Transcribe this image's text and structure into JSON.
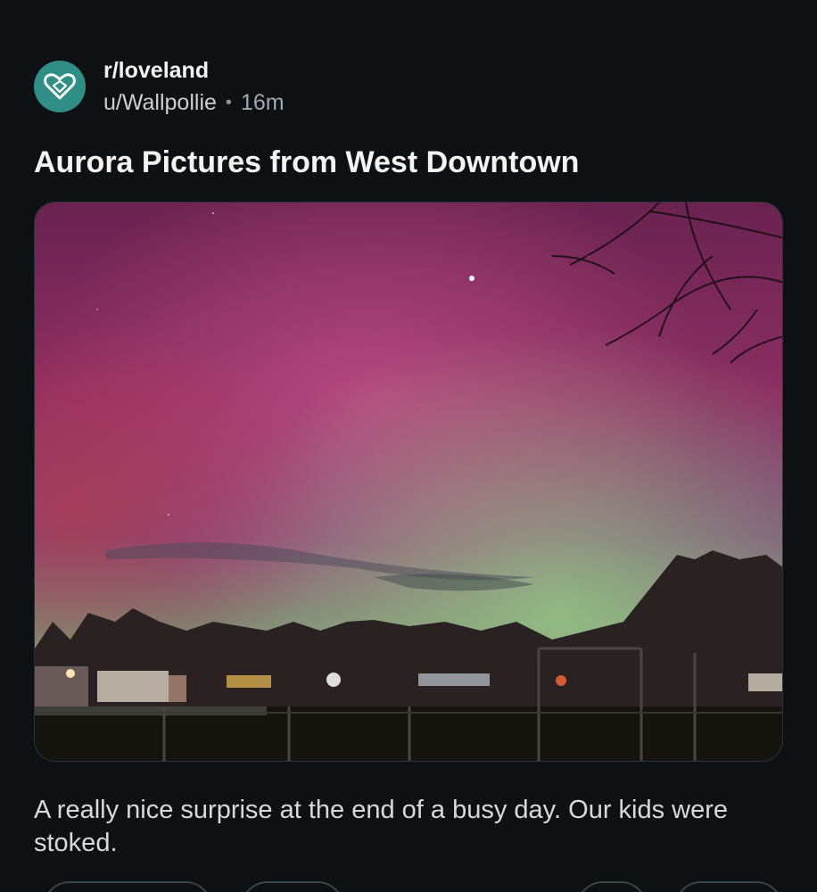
{
  "post": {
    "subreddit": "r/loveland",
    "username": "u/Wallpollie",
    "separator": "•",
    "time_ago": "16m",
    "title": "Aurora Pictures from West Downtown",
    "body": "A really nice surprise at the end of a busy day. Our kids were stoked."
  },
  "colors": {
    "background": "#0e1113",
    "avatar": "#2f8f86",
    "text_primary": "#f2f4f5",
    "text_secondary": "#a0a9ae"
  },
  "icons": {
    "avatar": "heart-icon"
  }
}
